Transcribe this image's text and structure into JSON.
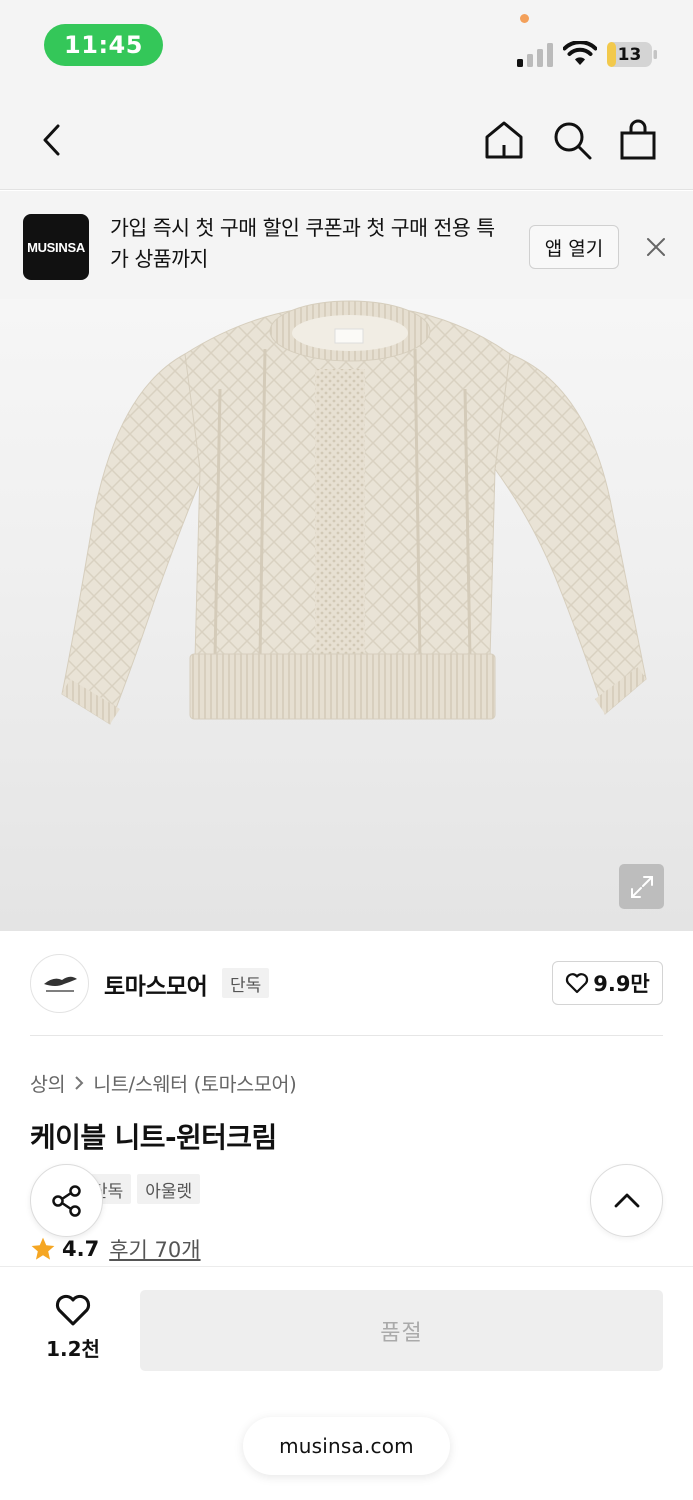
{
  "status_bar": {
    "time": "11:45",
    "battery": "13"
  },
  "nav": {
    "icons": [
      "chevron-left-icon",
      "home-icon",
      "search-icon",
      "shopping-bag-icon"
    ]
  },
  "app_banner": {
    "logo_text": "MUSINSA",
    "message": "가입 즉시 첫 구매 할인 쿠폰과 첫 구매 전용 특가 상품까지",
    "open_label": "앱 열기"
  },
  "brand": {
    "name": "토마스모어",
    "tag": "단독",
    "like_count": "9.9만"
  },
  "breadcrumb": {
    "category": "상의",
    "subcategory": "니트/스웨터 (토마스모어)"
  },
  "product": {
    "title": "케이블 니트-윈터크림",
    "tags": [
      "단독",
      "아울렛"
    ],
    "rating": "4.7",
    "reviews_label": "후기 70개"
  },
  "bottom_bar": {
    "wish_count": "1.2천",
    "soldout_label": "품절",
    "url": "musinsa.com"
  },
  "colors": {
    "time_pill": "#34c759",
    "star": "#f5a623",
    "soldout_bg": "#eeeeee"
  }
}
